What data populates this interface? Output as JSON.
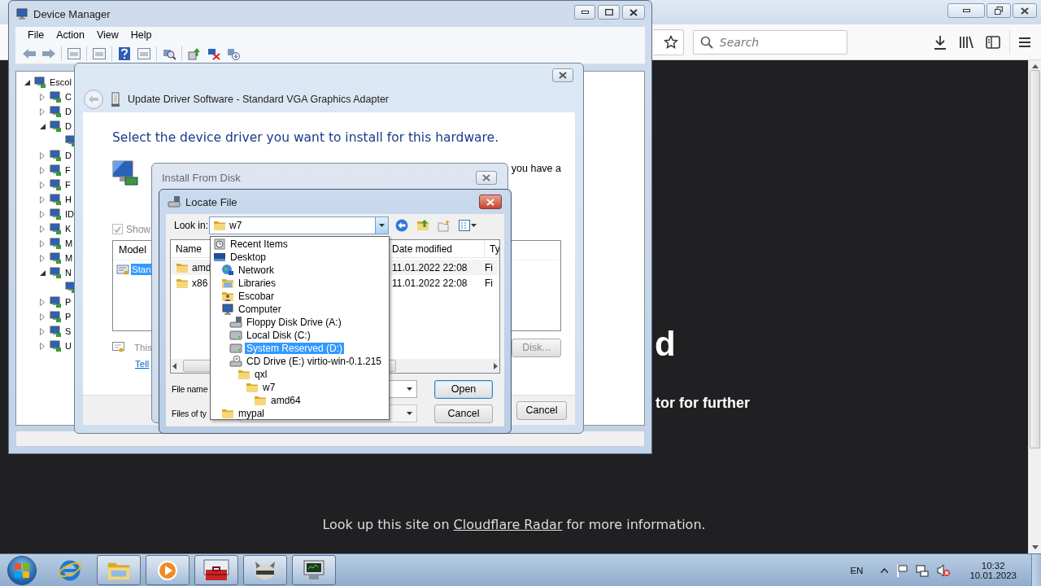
{
  "browser": {
    "search": {
      "placeholder": "Search"
    },
    "page": {
      "heading": "d",
      "subheading": "tor for further",
      "footer_prefix": "Look up this site on",
      "footer_link": "Cloudflare Radar",
      "footer_suffix": "for more information."
    }
  },
  "device_manager": {
    "title": "Device Manager",
    "menu": [
      "File",
      "Action",
      "View",
      "Help"
    ],
    "tree": [
      {
        "label": "Escol",
        "expanded": true,
        "children": [
          {
            "label": "C",
            "expanded": false
          },
          {
            "label": "D",
            "expanded": false
          },
          {
            "label": "D",
            "expanded": true,
            "children": [
              {
                "kind": "device"
              }
            ]
          },
          {
            "label": "D",
            "expanded": false
          },
          {
            "label": "F",
            "expanded": false
          },
          {
            "label": "F",
            "expanded": false
          },
          {
            "label": "H",
            "expanded": false
          },
          {
            "label": "ID",
            "expanded": false
          },
          {
            "label": "K",
            "expanded": false
          },
          {
            "label": "M",
            "expanded": false
          },
          {
            "label": "M",
            "expanded": false
          },
          {
            "label": "N",
            "expanded": true,
            "children": [
              {
                "kind": "device"
              }
            ]
          },
          {
            "label": "P",
            "expanded": false
          },
          {
            "label": "P",
            "expanded": false
          },
          {
            "label": "S",
            "expanded": false
          },
          {
            "label": "U",
            "expanded": false
          }
        ]
      }
    ]
  },
  "update_driver": {
    "title": "Update Driver Software - Standard VGA Graphics Adapter",
    "heading": "Select the device driver you want to install for this hardware.",
    "intro_fragment": "you have a",
    "show_checkbox": {
      "label": "Show",
      "checked": true,
      "disabled": true
    },
    "model_list": {
      "header": "Model",
      "items": [
        {
          "label": "Stan",
          "selected": true
        }
      ]
    },
    "have_disk_button": "Disk...",
    "note": "This",
    "link": "Tell",
    "cancel_button": "Cancel"
  },
  "install_from_disk": {
    "title": "Install From Disk"
  },
  "locate_file": {
    "title": "Locate File",
    "look_in_label": "Look in:",
    "look_in_value": "w7",
    "columns": [
      "Name",
      "Date modified",
      "Ty"
    ],
    "rows": [
      {
        "name": "amd",
        "date": "11.01.2022 22:08",
        "type": "Fi",
        "hovered": true
      },
      {
        "name": "x86",
        "date": "11.01.2022 22:08",
        "type": "Fi",
        "hovered": false
      }
    ],
    "file_name_label": "File name",
    "files_of_type_label": "Files of ty",
    "open_button": "Open",
    "cancel_button": "Cancel",
    "dropdown": [
      {
        "label": "Recent Items",
        "kind": "recent",
        "selected": false
      },
      {
        "label": "Desktop",
        "kind": "desktop",
        "selected": false,
        "children": [
          {
            "label": "Network",
            "kind": "network",
            "selected": false
          },
          {
            "label": "Libraries",
            "kind": "libraries",
            "selected": false
          },
          {
            "label": "Escobar",
            "kind": "user",
            "selected": false
          },
          {
            "label": "Computer",
            "kind": "computer",
            "selected": false,
            "children": [
              {
                "label": "Floppy Disk Drive (A:)",
                "kind": "floppy",
                "selected": false
              },
              {
                "label": "Local Disk (C:)",
                "kind": "disk",
                "selected": false
              },
              {
                "label": "System Reserved (D:)",
                "kind": "disk",
                "selected": true
              },
              {
                "label": "CD Drive (E:) virtio-win-0.1.215",
                "kind": "cd",
                "selected": false,
                "children": [
                  {
                    "label": "qxl",
                    "kind": "folder",
                    "selected": false,
                    "children": [
                      {
                        "label": "w7",
                        "kind": "folder",
                        "selected": false,
                        "children": [
                          {
                            "label": "amd64",
                            "kind": "folder",
                            "selected": false
                          }
                        ]
                      }
                    ]
                  }
                ]
              }
            ]
          },
          {
            "label": "mypal",
            "kind": "folder",
            "selected": false
          }
        ]
      }
    ]
  },
  "taskbar": {
    "apps": [
      {
        "kind": "browser",
        "running": false
      },
      {
        "kind": "folder",
        "running": true
      },
      {
        "kind": "media",
        "running": true
      },
      {
        "kind": "toolbox",
        "running": true
      },
      {
        "kind": "animal",
        "running": true
      },
      {
        "kind": "terminal",
        "running": true
      }
    ],
    "language": "EN",
    "time": "10:32",
    "date": "10.01.2023"
  }
}
